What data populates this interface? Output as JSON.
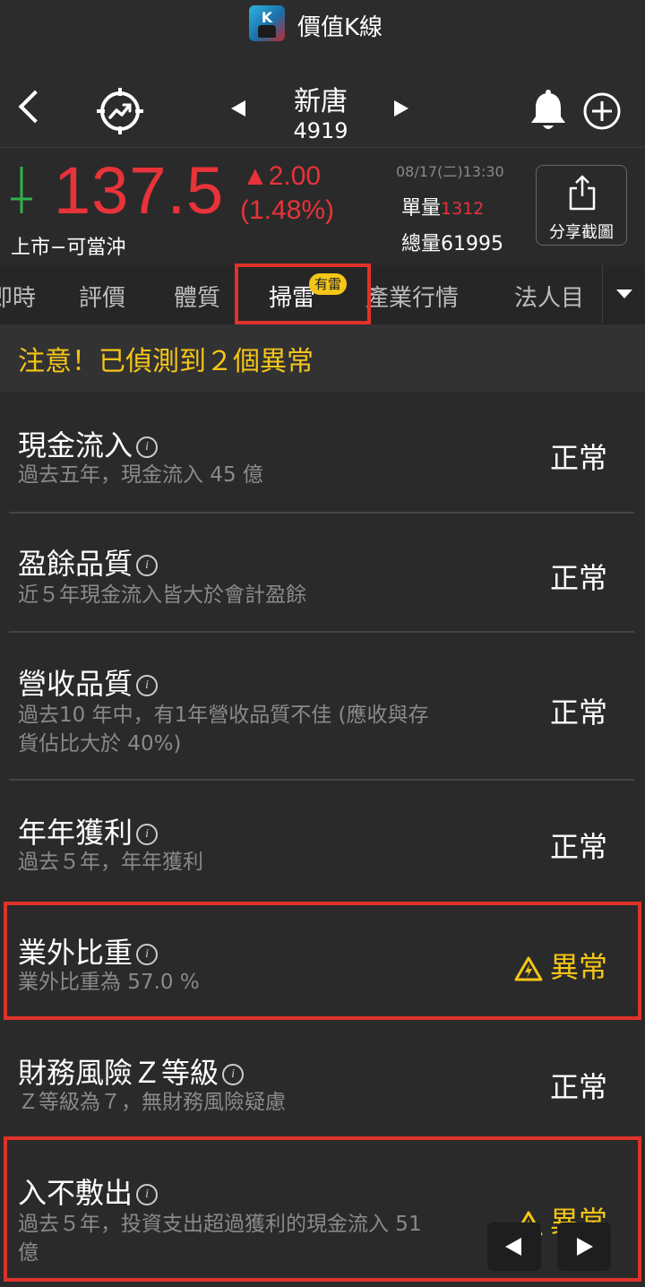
{
  "app": {
    "title": "價值K線",
    "logo_letter": "K"
  },
  "header": {
    "stock_name": "新唐",
    "stock_code": "4919"
  },
  "quote": {
    "price": "137.5",
    "change": "▲2.00",
    "change_pct": "(1.48%)",
    "market": "上市−可當沖",
    "datetime": "08/17(二)13:30",
    "single_vol_label": "單量",
    "single_vol_value": "1312",
    "total_vol_label": "總量",
    "total_vol_value": "61995",
    "share_label": "分享截圖",
    "up_color": "#e8333a",
    "down_arrow_color": "#2fb34a"
  },
  "tabs": {
    "items": [
      "即時",
      "評價",
      "體質",
      "掃雷",
      "產業行情",
      "法人目"
    ],
    "active": "掃雷",
    "badge": "有雷"
  },
  "banner": {
    "text": "注意！已偵測到２個異常"
  },
  "checks": [
    {
      "title": "現金流入",
      "desc": "過去五年，現金流入 45 億",
      "status": "正常"
    },
    {
      "title": "盈餘品質",
      "desc": "近５年現金流入皆大於會計盈餘",
      "status": "正常"
    },
    {
      "title": "營收品質",
      "desc": "過去10 年中，有1年營收品質不佳 (應收與存貨佔比大於 40%)",
      "status": "正常"
    },
    {
      "title": "年年獲利",
      "desc": "過去５年，年年獲利",
      "status": "正常"
    },
    {
      "title": "業外比重",
      "desc": "業外比重為 57.0 %",
      "status": "異常"
    },
    {
      "title": "財務風險Ｚ等級",
      "desc": "Ｚ等級為７，無財務風險疑慮",
      "status": "正常"
    },
    {
      "title": "入不敷出",
      "desc": "過去５年，投資支出超過獲利的現金流入 51億",
      "status": "異常"
    }
  ],
  "colors": {
    "alert": "#f5c518",
    "highlight_border": "#e0322b",
    "background": "#2a2a2a"
  }
}
